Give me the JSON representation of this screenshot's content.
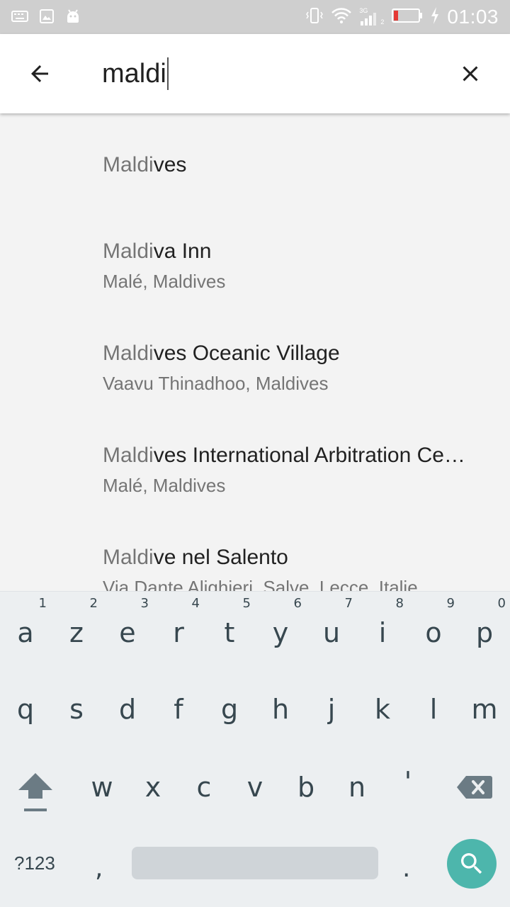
{
  "status_bar": {
    "time": "01:03",
    "network_type": "3G",
    "sim_slot": "2",
    "icons": [
      "keyboard-icon",
      "image-icon",
      "android-icon",
      "vibrate-icon",
      "wifi-icon",
      "signal-icon",
      "battery-icon",
      "charging-icon"
    ],
    "battery_color": "#e53935"
  },
  "search": {
    "query": "maldi",
    "back_icon": "arrow-back-icon",
    "clear_icon": "close-icon"
  },
  "results": [
    {
      "match": "Maldi",
      "rest": "ves",
      "subtitle": ""
    },
    {
      "match": "Maldi",
      "rest": "va Inn",
      "subtitle": "Malé, Maldives"
    },
    {
      "match": "Maldi",
      "rest": "ves Oceanic Village",
      "subtitle": "Vaavu Thinadhoo, Maldives"
    },
    {
      "match": "Maldi",
      "rest": "ves International Arbitration Ce…",
      "subtitle": "Malé, Maldives"
    },
    {
      "match": "Maldi",
      "rest": "ve nel Salento",
      "subtitle": "Via Dante Alighieri, Salve, Lecce, Italie"
    }
  ],
  "keyboard": {
    "row1": [
      "a",
      "z",
      "e",
      "r",
      "t",
      "y",
      "u",
      "i",
      "o",
      "p"
    ],
    "row1_hints": [
      "1",
      "2",
      "3",
      "4",
      "5",
      "6",
      "7",
      "8",
      "9",
      "0"
    ],
    "row2": [
      "q",
      "s",
      "d",
      "f",
      "g",
      "h",
      "j",
      "k",
      "l",
      "m"
    ],
    "row3": [
      "w",
      "x",
      "c",
      "v",
      "b",
      "n",
      "'"
    ],
    "symbols_label": "?123",
    "comma": ",",
    "period": ".",
    "accent_color": "#4db6ac"
  }
}
